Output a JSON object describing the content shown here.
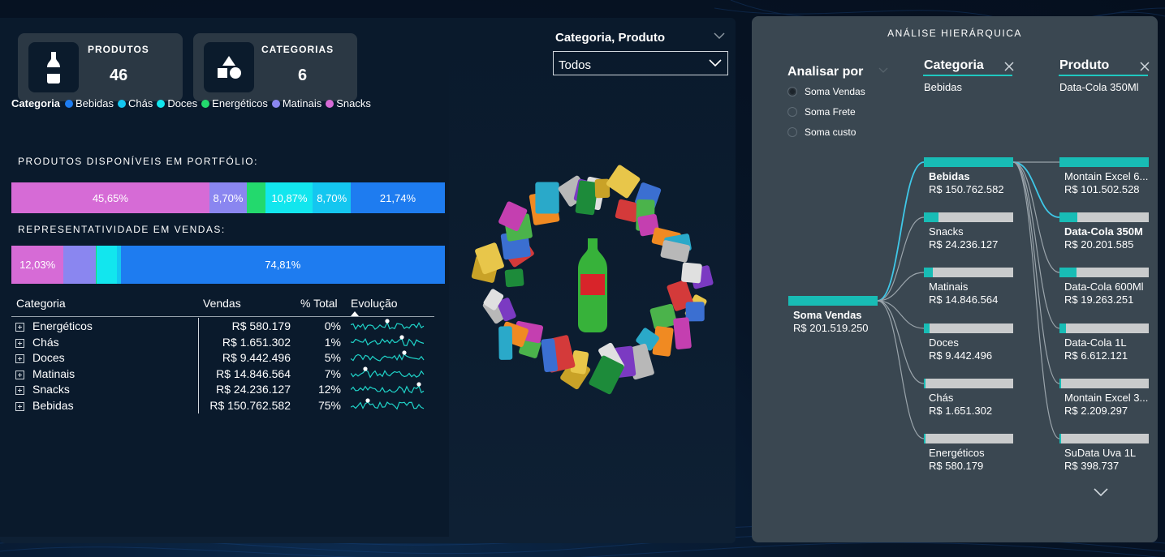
{
  "kpis": [
    {
      "label": "PRODUTOS",
      "value": "46",
      "icon": "bottle-icon"
    },
    {
      "label": "CATEGORIAS",
      "value": "6",
      "icon": "shapes-icon"
    }
  ],
  "legend": {
    "title": "Categoria",
    "items": [
      {
        "label": "Bebidas",
        "color": "#1e7cf0"
      },
      {
        "label": "Chás",
        "color": "#14c6f0"
      },
      {
        "label": "Doces",
        "color": "#12e6ee"
      },
      {
        "label": "Energéticos",
        "color": "#23d96d"
      },
      {
        "label": "Matinais",
        "color": "#8a86f0"
      },
      {
        "label": "Snacks",
        "color": "#d66bd6"
      }
    ]
  },
  "portfolio": {
    "title": "PRODUTOS DISPONÍVEIS EM PORTFÓLIO:",
    "segments": [
      {
        "category": "Snacks",
        "share": 45.65,
        "label": "45,65%",
        "color": "#d66bd6"
      },
      {
        "category": "Matinais",
        "share": 8.7,
        "label": "8,70%",
        "color": "#8a86f0"
      },
      {
        "category": "Energéticos",
        "share": 4.35,
        "label": "",
        "color": "#23d96d"
      },
      {
        "category": "Doces",
        "share": 10.87,
        "label": "10,87%",
        "color": "#12e6ee"
      },
      {
        "category": "Chás",
        "share": 8.7,
        "label": "8,70%",
        "color": "#14c6f0"
      },
      {
        "category": "Bebidas",
        "share": 21.74,
        "label": "21,74%",
        "color": "#1e7cf0"
      }
    ]
  },
  "sales_share": {
    "title": "REPRESENTATIVIDADE EM VENDAS:",
    "segments": [
      {
        "category": "Snacks",
        "share": 12.03,
        "label": "12,03%",
        "color": "#d66bd6"
      },
      {
        "category": "Matinais",
        "share": 7.37,
        "label": "",
        "color": "#8a86f0"
      },
      {
        "category": "Energéticos",
        "share": 0.29,
        "label": "",
        "color": "#23d96d"
      },
      {
        "category": "Doces",
        "share": 4.69,
        "label": "",
        "color": "#12e6ee"
      },
      {
        "category": "Chás",
        "share": 0.82,
        "label": "",
        "color": "#14c6f0"
      },
      {
        "category": "Bebidas",
        "share": 74.81,
        "label": "74,81%",
        "color": "#1e7cf0"
      }
    ]
  },
  "table": {
    "headers": {
      "category": "Categoria",
      "sales": "Vendas",
      "pct": "% Total",
      "trend": "Evolução"
    },
    "rows": [
      {
        "category": "Energéticos",
        "sales": "R$ 580.179",
        "pct": "0%"
      },
      {
        "category": "Chás",
        "sales": "R$ 1.651.302",
        "pct": "1%"
      },
      {
        "category": "Doces",
        "sales": "R$ 9.442.496",
        "pct": "5%"
      },
      {
        "category": "Matinais",
        "sales": "R$ 14.846.564",
        "pct": "7%"
      },
      {
        "category": "Snacks",
        "sales": "R$ 24.236.127",
        "pct": "12%"
      },
      {
        "category": "Bebidas",
        "sales": "R$ 150.762.582",
        "pct": "75%"
      }
    ]
  },
  "slicer": {
    "title": "Categoria, Produto",
    "value": "Todos"
  },
  "decomposition": {
    "title": "ANÁLISE HIERÁRQUICA",
    "analyze_label": "Analisar por",
    "measures": [
      {
        "label": "Soma Vendas",
        "selected": true
      },
      {
        "label": "Soma Frete",
        "selected": false
      },
      {
        "label": "Soma custo",
        "selected": false
      }
    ],
    "levels": [
      {
        "name": "Categoria",
        "selected": "Bebidas"
      },
      {
        "name": "Produto",
        "selected": "Data-Cola 350Ml"
      }
    ],
    "root": {
      "name": "Soma Vendas",
      "value": "R$ 201.519.250",
      "fraction": 1.0
    },
    "categories": [
      {
        "name": "Bebidas",
        "value": "R$ 150.762.582",
        "fraction": 1.0,
        "bold": true
      },
      {
        "name": "Snacks",
        "value": "R$ 24.236.127",
        "fraction": 0.16
      },
      {
        "name": "Matinais",
        "value": "R$ 14.846.564",
        "fraction": 0.1
      },
      {
        "name": "Doces",
        "value": "R$ 9.442.496",
        "fraction": 0.06
      },
      {
        "name": "Chás",
        "value": "R$ 1.651.302",
        "fraction": 0.01
      },
      {
        "name": "Energéticos",
        "value": "R$ 580.179",
        "fraction": 0.004
      }
    ],
    "products": [
      {
        "name": "Montain Excel 6...",
        "value": "R$ 101.502.528",
        "fraction": 1.0
      },
      {
        "name": "Data-Cola 350M",
        "value": "R$ 20.201.585",
        "fraction": 0.2,
        "bold": true
      },
      {
        "name": "Data-Cola 600Ml",
        "value": "R$ 19.263.251",
        "fraction": 0.19
      },
      {
        "name": "Data-Cola 1L",
        "value": "R$ 6.612.121",
        "fraction": 0.07
      },
      {
        "name": "Montain Excel 3...",
        "value": "R$ 2.209.297",
        "fraction": 0.02
      },
      {
        "name": "SuData Uva 1L",
        "value": "R$ 398.737",
        "fraction": 0.004
      }
    ]
  }
}
